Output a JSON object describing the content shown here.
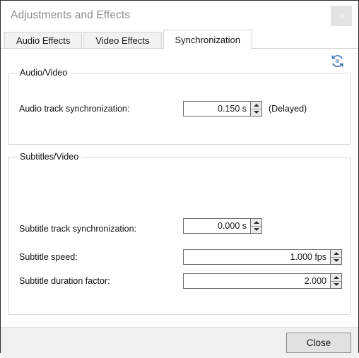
{
  "window": {
    "title": "Adjustments and Effects",
    "close_label": "×"
  },
  "tabs": [
    {
      "label": "Audio Effects",
      "active": false
    },
    {
      "label": "Video Effects",
      "active": false
    },
    {
      "label": "Synchronization",
      "active": true
    }
  ],
  "toolbar": {
    "reset_icon": "refresh-icon",
    "reset_color": "#3a6cb0"
  },
  "groups": {
    "audio_video": {
      "title": "Audio/Video",
      "rows": [
        {
          "label": "Audio track synchronization:",
          "value": "0.150 s",
          "suffix": "(Delayed)"
        }
      ]
    },
    "subtitles_video": {
      "title": "Subtitles/Video",
      "rows": [
        {
          "label": "Subtitle track synchronization:",
          "value": "0.000 s",
          "suffix": ""
        },
        {
          "label": "Subtitle speed:",
          "value": "1.000 fps",
          "suffix": ""
        },
        {
          "label": "Subtitle duration factor:",
          "value": "2.000",
          "suffix": ""
        }
      ]
    }
  },
  "footer": {
    "close_button": "Close"
  }
}
